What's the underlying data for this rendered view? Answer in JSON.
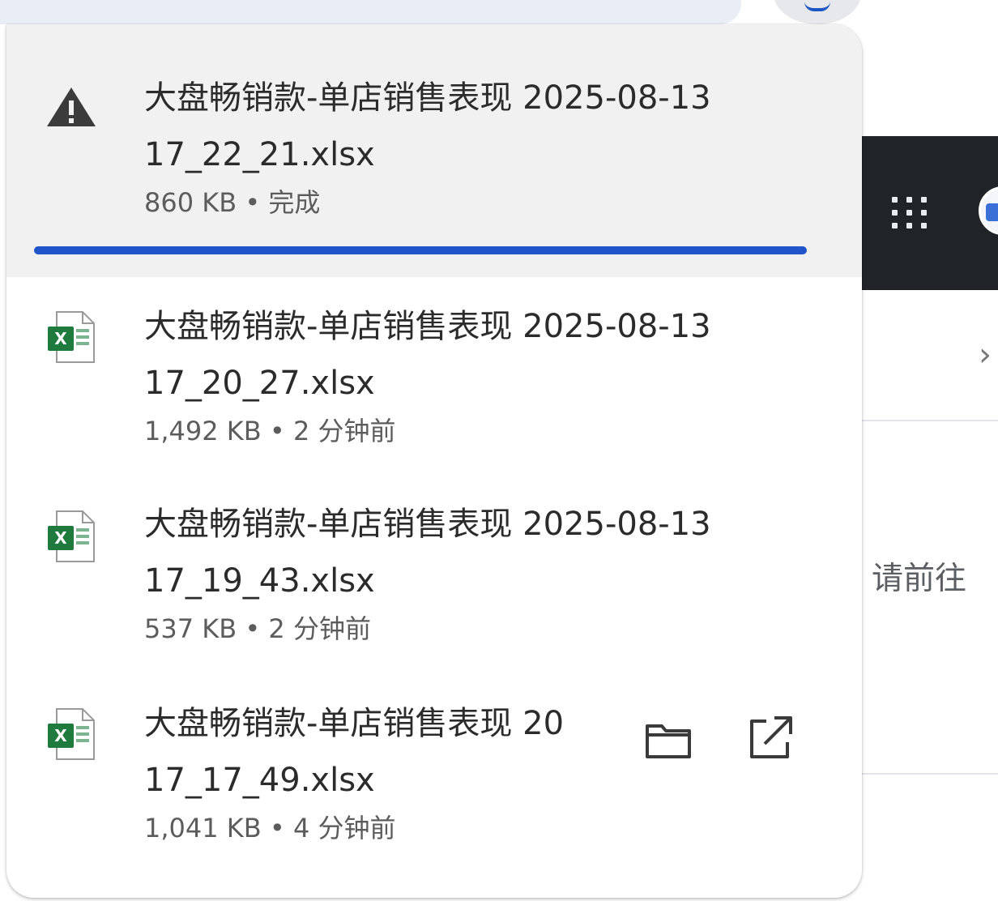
{
  "background": {
    "right_label": "请前往"
  },
  "downloads": [
    {
      "icon": "warning-icon",
      "name_line1": "大盘畅销款-单店销售表现 2025-08-13",
      "name_line2": "17_22_21.xlsx",
      "meta": "860 KB • 完成",
      "progress": 1.0,
      "highlighted": true
    },
    {
      "icon": "excel-file-icon",
      "name_line1": "大盘畅销款-单店销售表现 2025-08-13",
      "name_line2": "17_20_27.xlsx",
      "meta": "1,492 KB • 2 分钟前"
    },
    {
      "icon": "excel-file-icon",
      "name_line1": "大盘畅销款-单店销售表现 2025-08-13",
      "name_line2": "17_19_43.xlsx",
      "meta": "537 KB • 2 分钟前"
    },
    {
      "icon": "excel-file-icon",
      "name_line1": "大盘畅销款-单店销售表现 20",
      "name_line2": "17_17_49.xlsx",
      "meta": "1,041 KB • 4 分钟前",
      "actions": [
        "folder-icon",
        "open-external-icon"
      ]
    }
  ],
  "colors": {
    "progress": "#1f55c8",
    "highlight": "#f1f1f1",
    "excel_green": "#1f7a3e",
    "header_dark": "#202328"
  }
}
